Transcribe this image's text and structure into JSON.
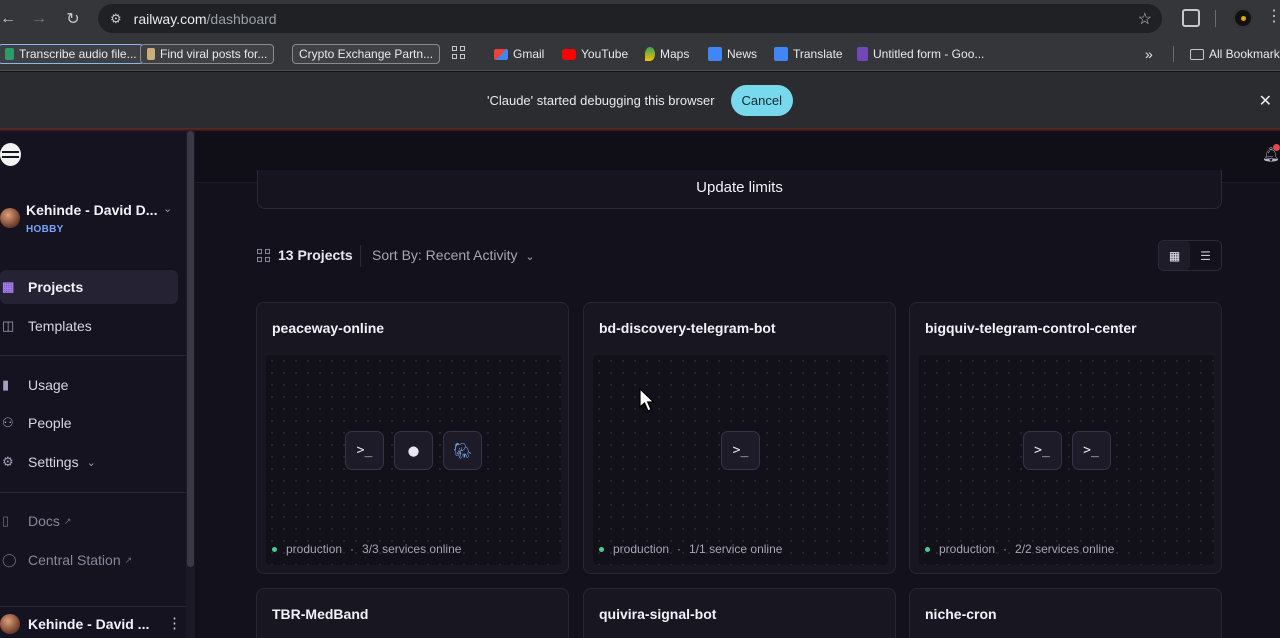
{
  "browser": {
    "url_host": "railway.com",
    "url_path": "/dashboard",
    "bookmarks": [
      {
        "label": "Transcribe audio file..."
      },
      {
        "label": "Find viral posts for..."
      },
      {
        "label": "Crypto Exchange Partn..."
      },
      {
        "label": "Gmail"
      },
      {
        "label": "YouTube"
      },
      {
        "label": "Maps"
      },
      {
        "label": "News"
      },
      {
        "label": "Translate"
      },
      {
        "label": "Untitled form - Goo..."
      },
      {
        "label": "All Bookmarks"
      }
    ],
    "more_label": "»",
    "infobar_message": "'Claude' started debugging this browser",
    "infobar_cancel": "Cancel"
  },
  "sidebar": {
    "account_name": "Kehinde - David D...",
    "account_plan": "HOBBY",
    "nav": [
      {
        "label": "Projects"
      },
      {
        "label": "Templates"
      },
      {
        "label": "Usage"
      },
      {
        "label": "People"
      },
      {
        "label": "Settings"
      },
      {
        "label": "Docs"
      },
      {
        "label": "Central Station"
      }
    ],
    "footer_name": "Kehinde - David ..."
  },
  "main": {
    "update_limits": "Update limits",
    "project_count": "13 Projects",
    "sort_label": "Sort By: Recent Activity",
    "projects": [
      {
        "name": "peaceway-online",
        "env": "production",
        "status": "3/3 services online"
      },
      {
        "name": "bd-discovery-telegram-bot",
        "env": "production",
        "status": "1/1 service online"
      },
      {
        "name": "bigquiv-telegram-control-center",
        "env": "production",
        "status": "2/2 services online"
      },
      {
        "name": "TBR-MedBand"
      },
      {
        "name": "quivira-signal-bot"
      },
      {
        "name": "niche-cron"
      }
    ]
  },
  "colors": {
    "accent": "#a27cf0",
    "online": "#3fcf8e",
    "plan": "#7aa2ff",
    "cancel_button": "#78d9ec"
  }
}
